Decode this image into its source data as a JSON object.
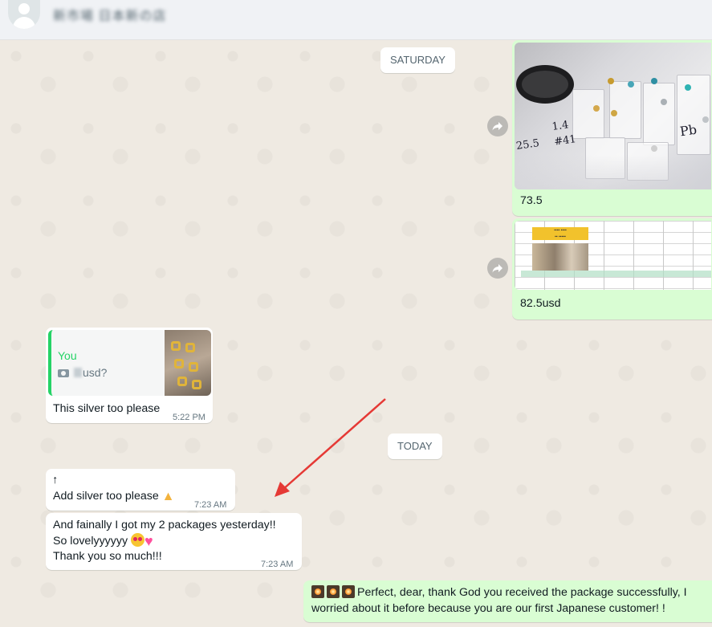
{
  "header": {
    "contact_name": "新市場 日本新の店"
  },
  "chat": {
    "dividers": {
      "saturday": "SATURDAY",
      "today": "TODAY"
    },
    "messages": {
      "out_photo_caption": "73.5",
      "out_sheet_caption": "82.5usd",
      "quote_author": "You",
      "quote_text": "usd?",
      "reply_text": "This silver too please",
      "reply_time": "5:22 PM",
      "arrow_line": "↑",
      "add_silver": "Add silver too please",
      "add_silver_time": "7:23 AM",
      "thanks_line1": "And fainally I got my 2 packages yesterday!!",
      "thanks_line2": "So lovelyyyyyy",
      "thanks_line3": "Thank you so much!!!",
      "thanks_time": "7:23 AM",
      "reply_out_line1": "Perfect, dear, thank God you received the package successfully, I",
      "reply_out_line2": "worried about it before because you are our first Japanese customer! !"
    }
  },
  "colors": {
    "chat_bg": "#efeae2",
    "incoming": "#ffffff",
    "outgoing": "#d9fdd3",
    "quote_accent": "#25d366",
    "annotation_arrow": "#e53935"
  },
  "icons": [
    "default-avatar-icon",
    "forward-icon",
    "camera-icon",
    "pray-emoji",
    "heart-eyes-emoji",
    "heart-emoji",
    "sparkler-emoji"
  ]
}
